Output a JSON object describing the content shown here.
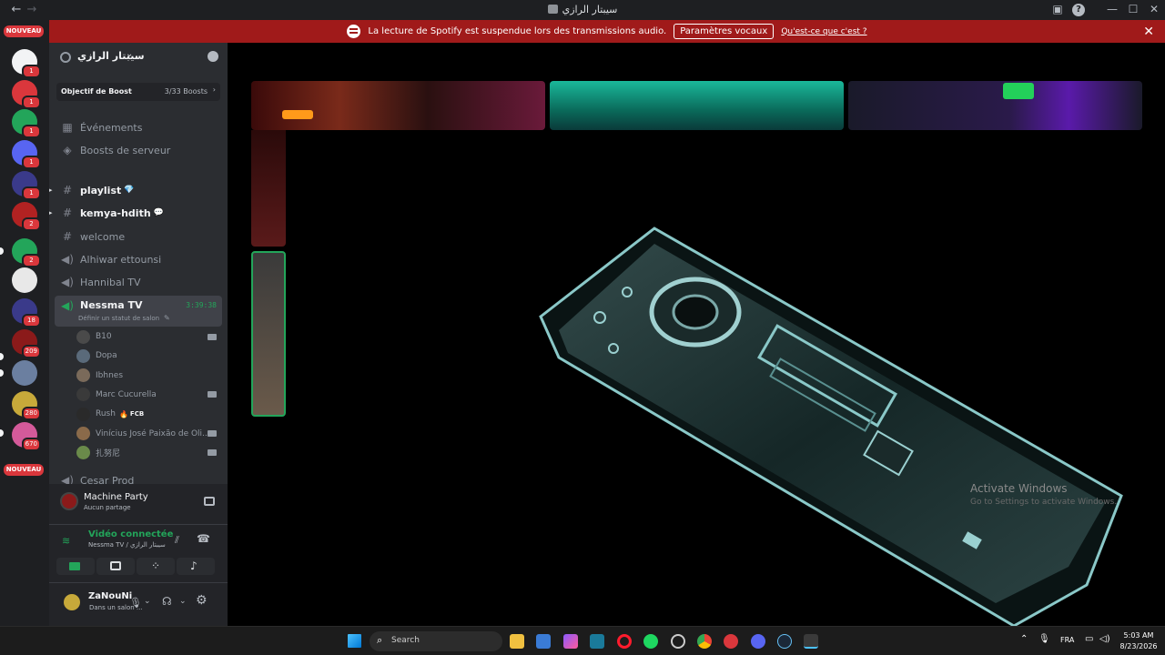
{
  "window": {
    "title": "سيبتار الرازي",
    "back_glyph": "←",
    "forward_glyph": "→",
    "controls": {
      "inbox": "inbox-icon",
      "help": "?",
      "minimize": "—",
      "maximize": "☐",
      "close": "✕"
    }
  },
  "banner": {
    "message": "La lecture de Spotify est suspendue lors des transmissions audio.",
    "button_label": "Paramètres vocaux",
    "link_label": "Qu'est-ce que c'est ?",
    "close_glyph": "✕",
    "color": "#a01a1a"
  },
  "rail": {
    "new_tag_top": "NOUVEAU",
    "new_tag_bottom": "NOUVEAU",
    "servers": [
      {
        "name": "server-1",
        "badge": "1",
        "color": "#f2f3f5"
      },
      {
        "name": "server-2",
        "badge": "1",
        "color": "#da373c"
      },
      {
        "name": "server-3",
        "badge": "1",
        "color": "#23a55a"
      },
      {
        "name": "server-4",
        "badge": "1",
        "color": "#5865f2"
      },
      {
        "name": "server-5",
        "badge": "1",
        "color": "#3a3a8a"
      },
      {
        "name": "server-6",
        "badge": "2",
        "color": "#b22222"
      },
      {
        "name": "server-7",
        "badge": "2",
        "color": "#23a55a"
      },
      {
        "name": "server-8",
        "badge": "",
        "color": "#e8e8e8"
      },
      {
        "name": "server-9",
        "badge": "18",
        "color": "#3a3a8a"
      },
      {
        "name": "server-10",
        "badge": "209",
        "color": "#8b1a1a"
      },
      {
        "name": "server-11",
        "badge": "",
        "color": "#6b7fa0"
      },
      {
        "name": "server-12",
        "badge": "280",
        "color": "#c7a93a"
      },
      {
        "name": "server-13",
        "badge": "670",
        "color": "#d45a9a"
      }
    ]
  },
  "sidebar": {
    "server_name": "سيبتار الرازي",
    "boost_label": "Objectif de Boost",
    "boost_count": "3/33 Boosts",
    "menu": [
      {
        "label": "Événements",
        "icon": "calendar-icon"
      },
      {
        "label": "Boosts de serveur",
        "icon": "boost-icon"
      }
    ],
    "channels": [
      {
        "label": "playlist",
        "type": "text",
        "emoji": "💎"
      },
      {
        "label": "kemya-hdith",
        "type": "text",
        "emoji": "💬"
      },
      {
        "label": "welcome",
        "type": "text",
        "emoji": ""
      },
      {
        "label": "Alhiwar ettounsi",
        "type": "voice",
        "emoji": ""
      },
      {
        "label": "Hannibal TV",
        "type": "voice",
        "emoji": ""
      }
    ],
    "active_channel": {
      "label": "Nessma TV",
      "timer": "3:39:38",
      "status_hint": "Définir un statut de salon"
    },
    "members": [
      {
        "name": "B10",
        "camera": true,
        "color": "#4a4a4a"
      },
      {
        "name": "Dopa",
        "camera": false,
        "color": "#5a6a7a"
      },
      {
        "name": "Ibhnes",
        "camera": false,
        "color": "#7a6a5a"
      },
      {
        "name": "Marc Cucurella",
        "camera": true,
        "color": "#3a3a3a"
      },
      {
        "name": "Rush",
        "camera": false,
        "color": "#2a2a2a",
        "tag": "FCB"
      },
      {
        "name": "Vinícius José Paixão de Oli...",
        "camera": true,
        "color": "#8a6a4a"
      },
      {
        "name": "扎努尼",
        "camera": true,
        "color": "#6a8a4a"
      }
    ],
    "next_channel": "Cesar Prod"
  },
  "panel": {
    "activity_title": "Machine Party",
    "activity_sub": "Aucun partage",
    "voice_status": "Vidéo connectée",
    "voice_location": "Nessma TV / سيبتار الرازي",
    "user_name": "ZaNouNi",
    "user_status": "Dans un salon ...",
    "accent": "#23a55a"
  },
  "stage": {
    "watermark_title": "Activate Windows",
    "watermark_sub": "Go to Settings to activate Windows."
  },
  "taskbar": {
    "search_placeholder": "Search",
    "language": "FRA",
    "time": "5:03 AM",
    "date": "8/23/2026"
  }
}
